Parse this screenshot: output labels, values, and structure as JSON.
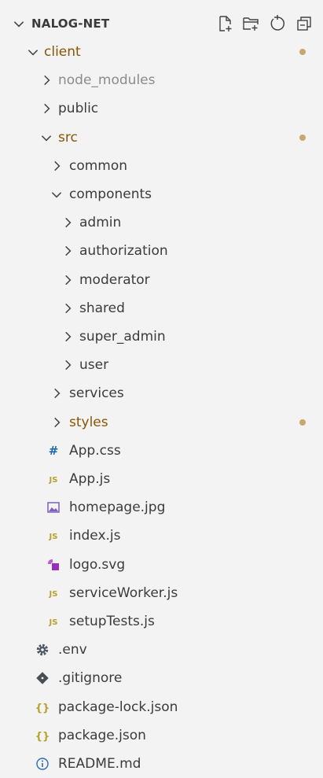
{
  "explorer": {
    "title": "NALOG-NET",
    "actions": [
      "new-file-icon",
      "new-folder-icon",
      "refresh-icon",
      "collapse-all-icon"
    ]
  },
  "colors": {
    "modified_text": "#895503",
    "modified_dot": "#c9a76a",
    "ignored_text": "#8b8b8b",
    "js_icon": "#b7a12b",
    "css_icon": "#1e6aa6",
    "image_icon": "#7a5fc0",
    "svg_icon": "#9b30b8"
  },
  "tree": [
    {
      "label": "client",
      "type": "folder",
      "open": true,
      "depth": 1,
      "modified": true
    },
    {
      "label": "node_modules",
      "type": "folder",
      "open": false,
      "depth": 2,
      "ignored": true
    },
    {
      "label": "public",
      "type": "folder",
      "open": false,
      "depth": 2
    },
    {
      "label": "src",
      "type": "folder",
      "open": true,
      "depth": 2,
      "modified": true
    },
    {
      "label": "common",
      "type": "folder",
      "open": false,
      "depth": 3
    },
    {
      "label": "components",
      "type": "folder",
      "open": true,
      "depth": 3
    },
    {
      "label": "admin",
      "type": "folder",
      "open": false,
      "depth": 4
    },
    {
      "label": "authorization",
      "type": "folder",
      "open": false,
      "depth": 4
    },
    {
      "label": "moderator",
      "type": "folder",
      "open": false,
      "depth": 4
    },
    {
      "label": "shared",
      "type": "folder",
      "open": false,
      "depth": 4
    },
    {
      "label": "super_admin",
      "type": "folder",
      "open": false,
      "depth": 4
    },
    {
      "label": "user",
      "type": "folder",
      "open": false,
      "depth": 4
    },
    {
      "label": "services",
      "type": "folder",
      "open": false,
      "depth": 3
    },
    {
      "label": "styles",
      "type": "folder",
      "open": false,
      "depth": 3,
      "modified": true
    },
    {
      "label": "App.css",
      "type": "file",
      "icon": "hash-icon",
      "glyph": "#",
      "depth": 3
    },
    {
      "label": "App.js",
      "type": "file",
      "icon": "js-icon",
      "glyph": "JS",
      "depth": 3
    },
    {
      "label": "homepage.jpg",
      "type": "file",
      "icon": "image-icon",
      "depth": 3
    },
    {
      "label": "index.js",
      "type": "file",
      "icon": "js-icon",
      "glyph": "JS",
      "depth": 3
    },
    {
      "label": "logo.svg",
      "type": "file",
      "icon": "svg-icon",
      "depth": 3
    },
    {
      "label": "serviceWorker.js",
      "type": "file",
      "icon": "js-icon",
      "glyph": "JS",
      "depth": 3
    },
    {
      "label": "setupTests.js",
      "type": "file",
      "icon": "js-icon",
      "glyph": "JS",
      "depth": 3
    },
    {
      "label": ".env",
      "type": "file",
      "icon": "gear-icon",
      "depth": 2
    },
    {
      "label": ".gitignore",
      "type": "file",
      "icon": "git-icon",
      "depth": 2
    },
    {
      "label": "package-lock.json",
      "type": "file",
      "icon": "braces-icon",
      "glyph": "{}",
      "depth": 2
    },
    {
      "label": "package.json",
      "type": "file",
      "icon": "braces-icon",
      "glyph": "{}",
      "depth": 2
    },
    {
      "label": "README.md",
      "type": "file",
      "icon": "info-icon",
      "depth": 2
    }
  ]
}
